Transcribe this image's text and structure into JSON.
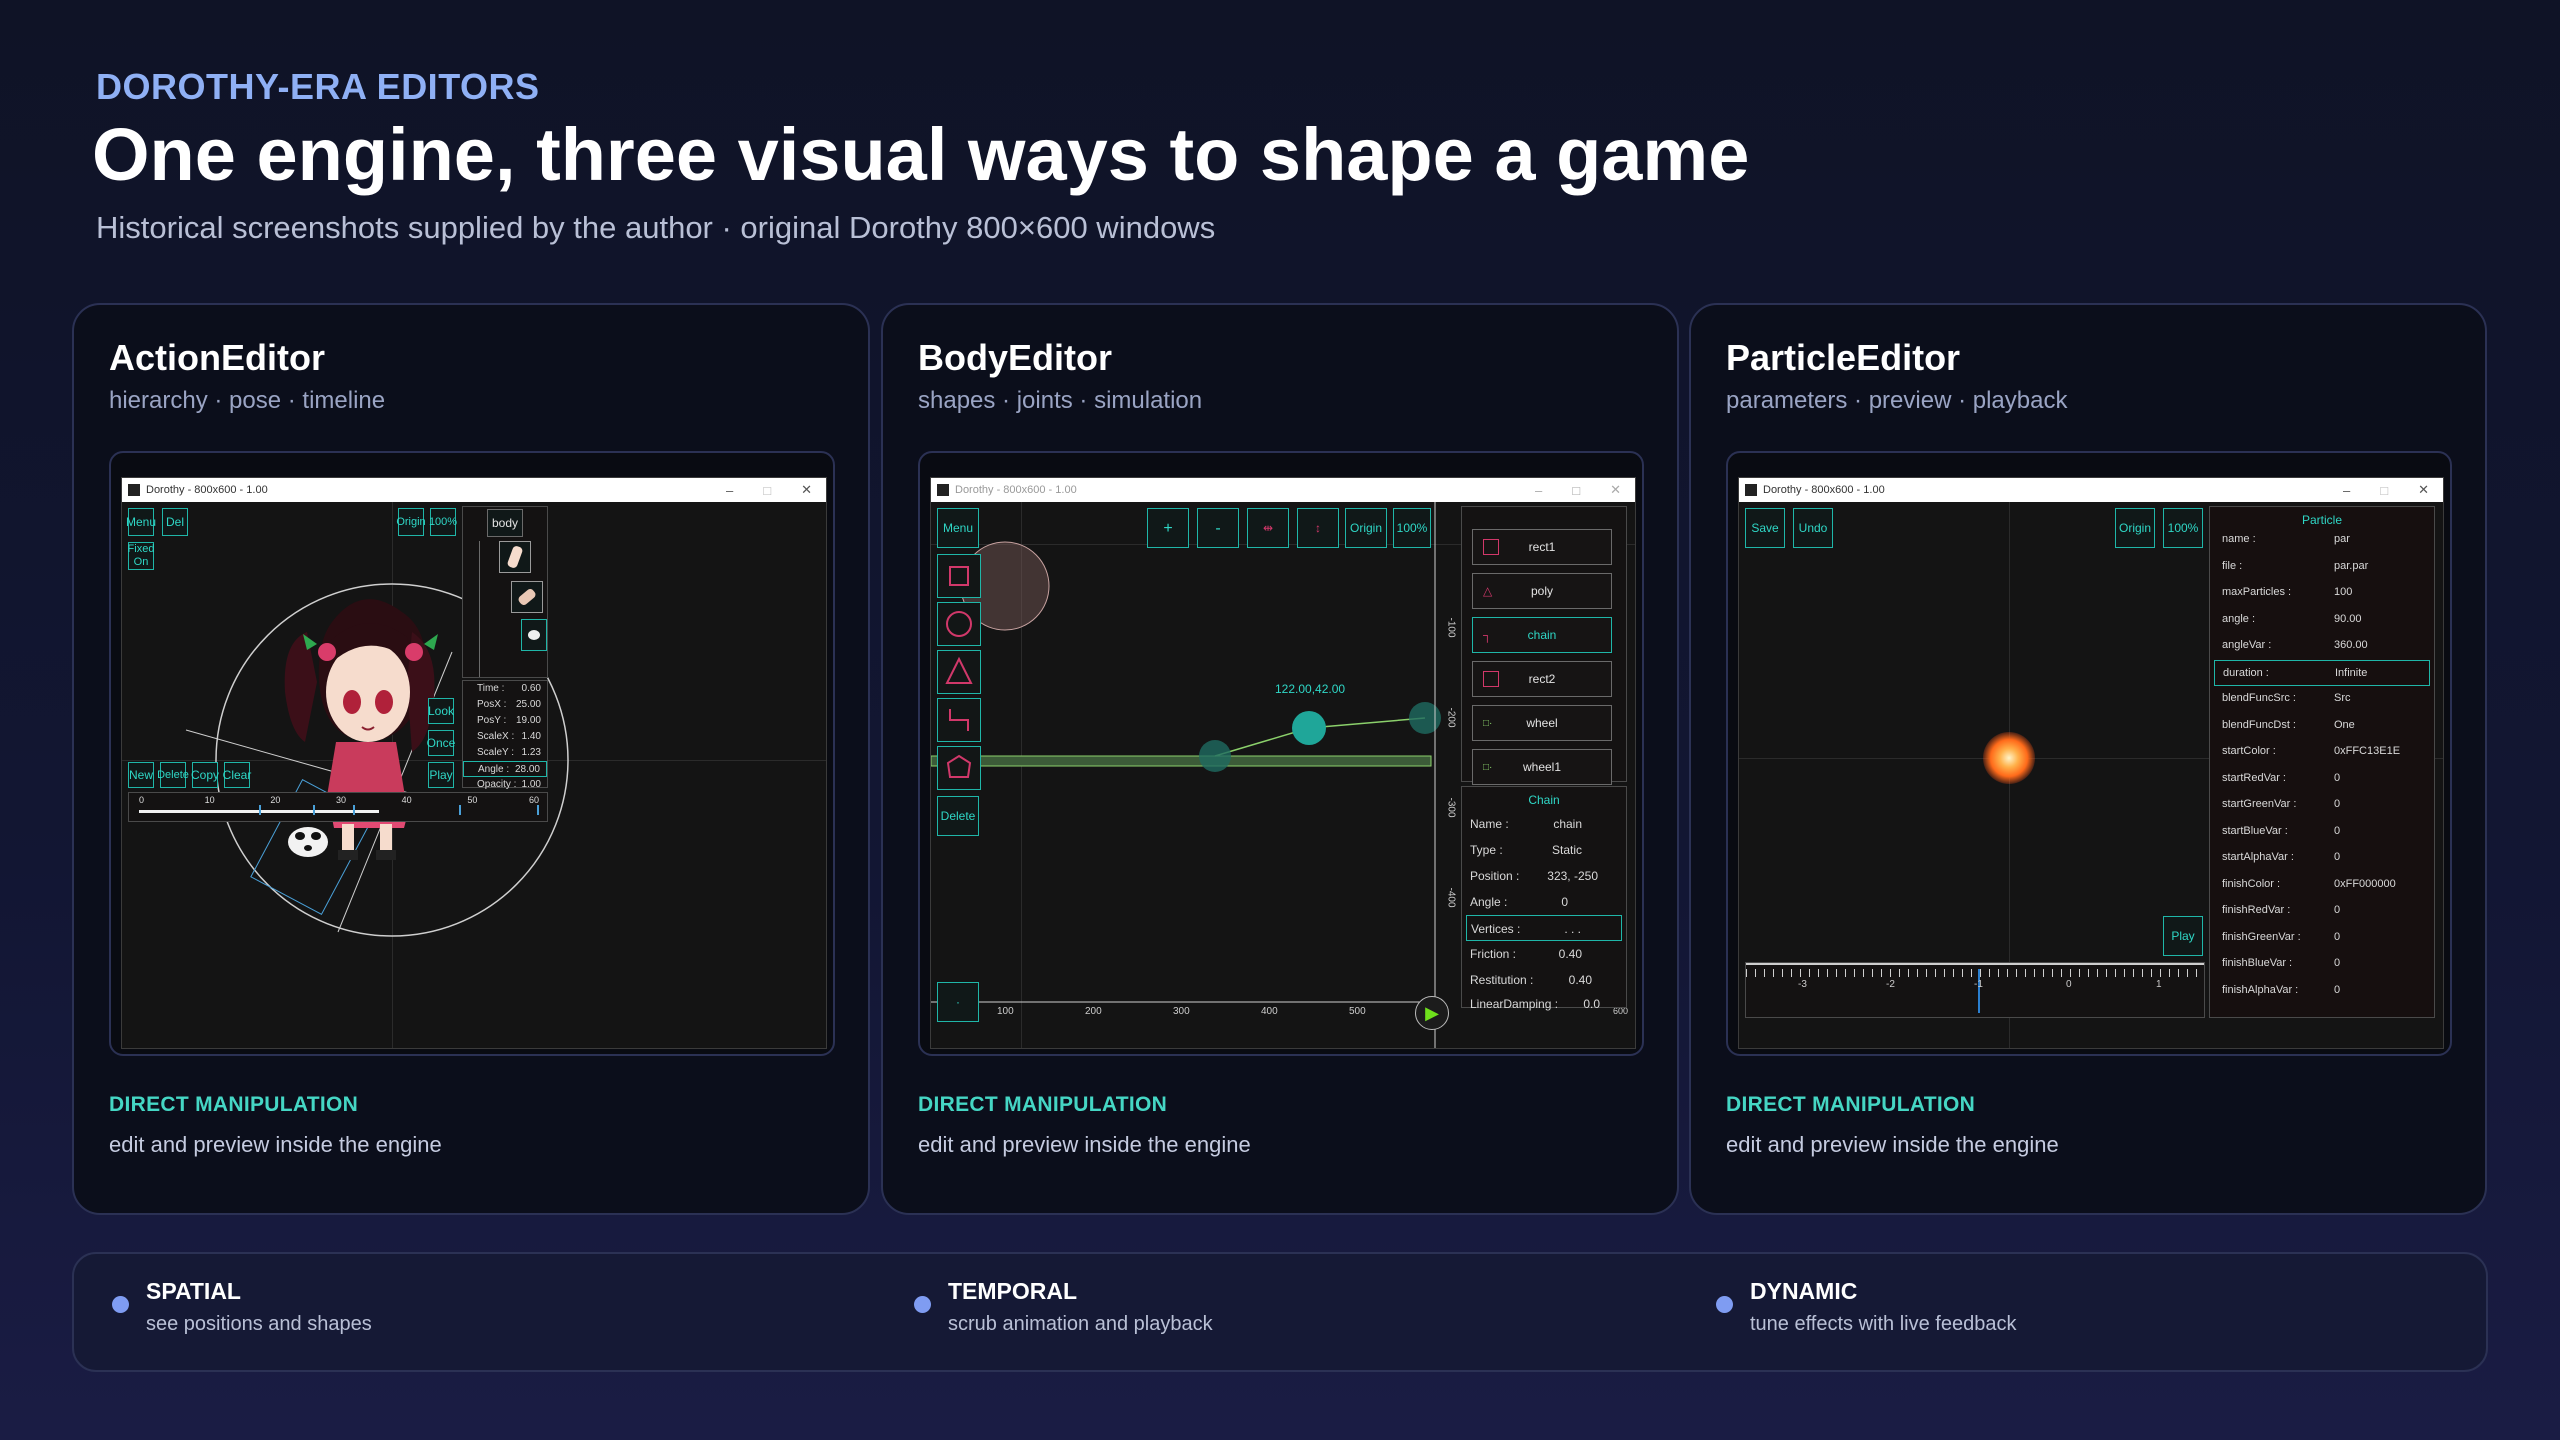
{
  "header": {
    "eyebrow": "DOROTHY-ERA EDITORS",
    "title": "One engine, three visual ways to shape a game",
    "subtitle": "Historical screenshots supplied by the author · original Dorothy 800×600 windows"
  },
  "cards": [
    {
      "title": "ActionEditor",
      "subtitle": "hierarchy · pose · timeline",
      "window_title": "Dorothy - 800x600 - 1.00",
      "buttons": {
        "menu": "Menu",
        "del": "Del",
        "fixed": "Fixed On",
        "origin": "Origin",
        "zoom": "100%",
        "look": "Look",
        "once": "Once",
        "play": "Play",
        "new": "New",
        "delete": "Delete",
        "copy": "Copy",
        "clear": "Clear"
      },
      "tree_root": "body",
      "props": [
        {
          "key": "Time :",
          "value": "0.60"
        },
        {
          "key": "PosX :",
          "value": "25.00"
        },
        {
          "key": "PosY :",
          "value": "19.00"
        },
        {
          "key": "ScaleX :",
          "value": "1.40"
        },
        {
          "key": "ScaleY :",
          "value": "1.23"
        },
        {
          "key": "Angle :",
          "value": "28.00"
        },
        {
          "key": "Opacity :",
          "value": "1.00"
        }
      ],
      "timeline_ticks": [
        "0",
        "10",
        "20",
        "30",
        "40",
        "50",
        "60"
      ],
      "dm_label": "DIRECT MANIPULATION",
      "dm_text": "edit and preview inside the engine"
    },
    {
      "title": "BodyEditor",
      "subtitle": "shapes · joints · simulation",
      "window_title": "Dorothy - 800x600 - 1.00",
      "buttons": {
        "menu": "Menu",
        "delete": "Delete",
        "plus": "+",
        "minus": "-",
        "origin": "Origin",
        "zoom": "100%"
      },
      "coord_label": "122.00,42.00",
      "shape_list": [
        "rect1",
        "poly",
        "chain",
        "rect2",
        "wheel",
        "wheel1"
      ],
      "panel_title": "Chain",
      "props": [
        {
          "key": "Name :",
          "value": "chain"
        },
        {
          "key": "Type :",
          "value": "Static"
        },
        {
          "key": "Position :",
          "value": "323, -250"
        },
        {
          "key": "Angle :",
          "value": "0"
        },
        {
          "key": "Vertices :",
          "value": ". . ."
        },
        {
          "key": "Friction :",
          "value": "0.40"
        },
        {
          "key": "Restitution :",
          "value": "0.40"
        },
        {
          "key": "LinearDamping :",
          "value": "0.0"
        }
      ],
      "ruler_x": [
        "100",
        "200",
        "300",
        "400",
        "500",
        "600"
      ],
      "ruler_y": [
        "-100",
        "-200",
        "-300",
        "-400"
      ],
      "dm_label": "DIRECT MANIPULATION",
      "dm_text": "edit and preview inside the engine"
    },
    {
      "title": "ParticleEditor",
      "subtitle": "parameters · preview · playback",
      "window_title": "Dorothy - 800x600 - 1.00",
      "buttons": {
        "save": "Save",
        "undo": "Undo",
        "origin": "Origin",
        "zoom": "100%",
        "play": "Play"
      },
      "panel_title": "Particle",
      "props": [
        {
          "key": "name :",
          "value": "par"
        },
        {
          "key": "file :",
          "value": "par.par"
        },
        {
          "key": "maxParticles :",
          "value": "100"
        },
        {
          "key": "angle :",
          "value": "90.00"
        },
        {
          "key": "angleVar :",
          "value": "360.00"
        },
        {
          "key": "duration :",
          "value": "Infinite"
        },
        {
          "key": "blendFuncSrc :",
          "value": "Src"
        },
        {
          "key": "blendFuncDst :",
          "value": "One"
        },
        {
          "key": "startColor :",
          "value": "0xFFC13E1E"
        },
        {
          "key": "startRedVar :",
          "value": "0"
        },
        {
          "key": "startGreenVar :",
          "value": "0"
        },
        {
          "key": "startBlueVar :",
          "value": "0"
        },
        {
          "key": "startAlphaVar :",
          "value": "0"
        },
        {
          "key": "finishColor :",
          "value": "0xFF000000"
        },
        {
          "key": "finishRedVar :",
          "value": "0"
        },
        {
          "key": "finishGreenVar :",
          "value": "0"
        },
        {
          "key": "finishBlueVar :",
          "value": "0"
        },
        {
          "key": "finishAlphaVar :",
          "value": "0"
        }
      ],
      "ruler_x": [
        "-3",
        "-2",
        "-1",
        "0",
        "1"
      ],
      "dm_label": "DIRECT MANIPULATION",
      "dm_text": "edit and preview inside the engine"
    }
  ],
  "features": [
    {
      "name": "SPATIAL",
      "text": "see positions and shapes"
    },
    {
      "name": "TEMPORAL",
      "text": "scrub animation and playback"
    },
    {
      "name": "DYNAMIC",
      "text": "tune effects with live feedback"
    }
  ],
  "colors": {
    "accent_teal": "#45d6c4",
    "accent_blue": "#8fb0f5",
    "particle": "#ff8a3a"
  }
}
